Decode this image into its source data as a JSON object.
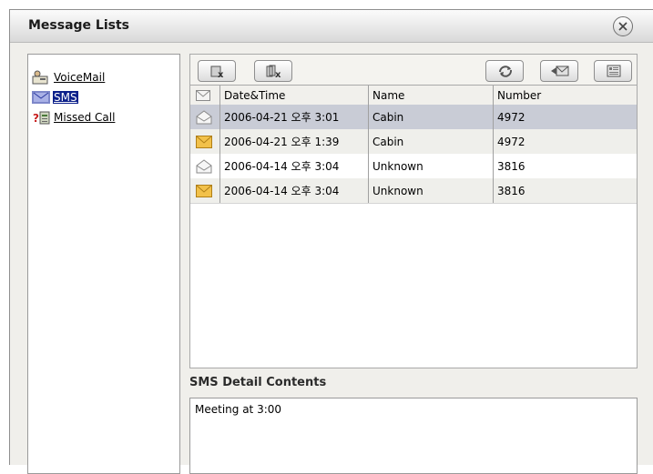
{
  "window": {
    "title": "Message Lists"
  },
  "tree": {
    "items": [
      {
        "label": "VoiceMail",
        "icon": "voicemail-icon",
        "selected": false
      },
      {
        "label": "SMS",
        "icon": "sms-icon",
        "selected": true
      },
      {
        "label": "Missed Call",
        "icon": "missed-call-icon",
        "selected": false
      }
    ]
  },
  "toolbar": {
    "buttons": [
      "delete-button",
      "delete-all-button",
      "refresh-button",
      "reply-button",
      "contacts-button"
    ]
  },
  "table": {
    "headers": [
      "",
      "Date&Time",
      "Name",
      "Number"
    ],
    "rows": [
      {
        "status": "read",
        "datetime": "2006-04-21 오후 3:01",
        "name": "Cabin",
        "number": "4972"
      },
      {
        "status": "unread",
        "datetime": "2006-04-21 오후 1:39",
        "name": "Cabin",
        "number": "4972"
      },
      {
        "status": "read",
        "datetime": "2006-04-14 오후 3:04",
        "name": "Unknown",
        "number": "3816"
      },
      {
        "status": "unread",
        "datetime": "2006-04-14 오후 3:04",
        "name": "Unknown",
        "number": "3816"
      }
    ]
  },
  "detail": {
    "label": "SMS Detail Contents",
    "content": "Meeting at 3:00"
  },
  "colors": {
    "selection": "#0b1f8a",
    "row_selected": "#c9ccd6",
    "envelope_unread": "#f2c14a"
  }
}
